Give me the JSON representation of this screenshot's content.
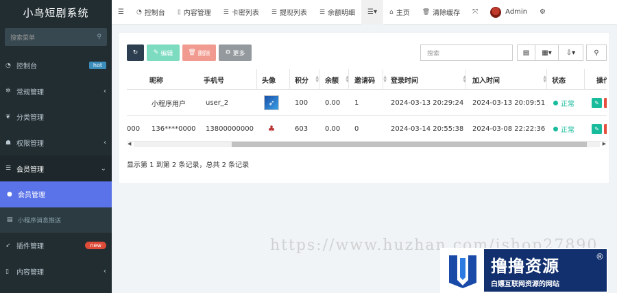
{
  "app": {
    "title": "小鸟短剧系统"
  },
  "sidebar": {
    "search_placeholder": "搜索菜单",
    "items": [
      {
        "label": "控制台",
        "badge": "hot",
        "icon": "dashboard-icon"
      },
      {
        "label": "常规管理",
        "icon": "cogs-icon"
      },
      {
        "label": "分类管理",
        "icon": "leaf-icon"
      },
      {
        "label": "权限管理",
        "icon": "group-icon"
      },
      {
        "label": "会员管理",
        "icon": "list-icon"
      },
      {
        "label": "会员管理",
        "icon": "user-icon"
      },
      {
        "label": "小程序消息推送",
        "icon": "list-alt-icon"
      },
      {
        "label": "插件管理",
        "badge": "new",
        "icon": "rocket-icon"
      },
      {
        "label": "内容管理",
        "icon": "file-icon"
      }
    ]
  },
  "topnav": {
    "items": [
      "控制台",
      "内容管理",
      "卡密列表",
      "提现列表",
      "余额明细"
    ],
    "home": "主页",
    "clear_cache": "清除缓存",
    "user": "Admin"
  },
  "toolbar": {
    "edit": "编辑",
    "delete": "删除",
    "more": "更多",
    "search_placeholder": "搜索"
  },
  "table": {
    "headers": [
      "昵称",
      "手机号",
      "头像",
      "积分",
      "余额",
      "邀请码",
      "登录时间",
      "加入时间",
      "状态",
      "操作"
    ],
    "rows": [
      {
        "nickname": "小程序用户",
        "phone": "user_2",
        "points": "100",
        "balance": "0.00",
        "invite": "1",
        "login_time": "2024-03-13 20:29:24",
        "join_time": "2024-03-13 20:09:51",
        "status": "正常"
      },
      {
        "id_tail": "000",
        "nickname": "136****0000",
        "phone": "13800000000",
        "points": "603",
        "balance": "0.00",
        "invite": "0",
        "login_time": "2024-03-14 20:55:38",
        "join_time": "2024-03-08 22:22:36",
        "status": "正常"
      }
    ]
  },
  "pager": {
    "text": "显示第 1 到第 2 条记录，总共 2 条记录"
  },
  "watermark": {
    "text": "https://www.huzhan.com/ishop27890"
  },
  "logo": {
    "title": "撸撸资源",
    "subtitle": "白嫖互联网资源的网站",
    "reg": "®"
  },
  "colors": {
    "sidebar_bg": "#222d32",
    "active": "#5b73e8",
    "status_ok": "#18bc9c"
  }
}
